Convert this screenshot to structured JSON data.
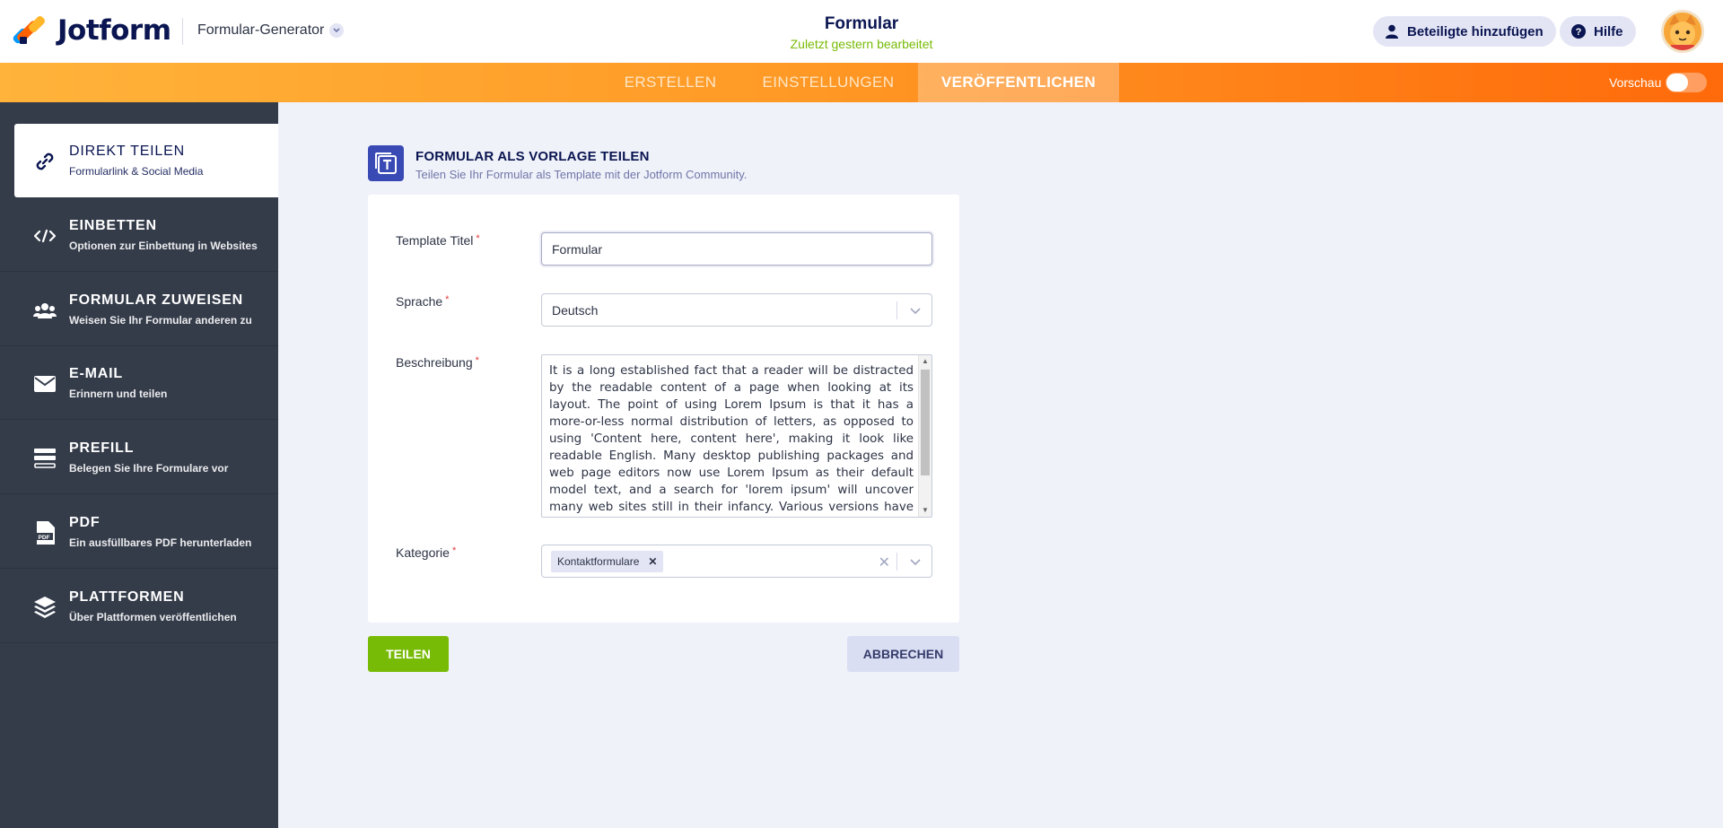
{
  "header": {
    "logo_text": "Jotform",
    "form_generator_label": "Formular-Generator",
    "form_title": "Formular",
    "form_subtitle": "Zuletzt gestern bearbeitet",
    "add_participants_label": "Beteiligte hinzufügen",
    "help_label": "Hilfe",
    "icons": [
      "user-icon",
      "help-icon",
      "chevron-down-icon"
    ]
  },
  "nav": {
    "tabs": [
      {
        "label": "ERSTELLEN"
      },
      {
        "label": "EINSTELLUNGEN"
      },
      {
        "label": "VERÖFFENTLICHEN",
        "active": true
      }
    ],
    "preview_label": "Vorschau",
    "preview_enabled": false
  },
  "sidebar": {
    "items": [
      {
        "title": "DIREKT TEILEN",
        "subtitle": "Formularlink & Social Media",
        "icon": "link-icon",
        "active": true
      },
      {
        "title": "EINBETTEN",
        "subtitle": "Optionen zur Einbettung in Websites",
        "icon": "code-icon"
      },
      {
        "title": "FORMULAR ZUWEISEN",
        "subtitle": "Weisen Sie Ihr Formular anderen zu",
        "icon": "users-icon"
      },
      {
        "title": "E-MAIL",
        "subtitle": "Erinnern und teilen",
        "icon": "mail-icon"
      },
      {
        "title": "PREFILL",
        "subtitle": "Belegen Sie Ihre Formulare vor",
        "icon": "prefill-icon"
      },
      {
        "title": "PDF",
        "subtitle": "Ein ausfüllbares PDF herunterladen",
        "icon": "pdf-icon"
      },
      {
        "title": "PLATTFORMEN",
        "subtitle": "Über Plattformen veröffentlichen",
        "icon": "layers-icon"
      }
    ]
  },
  "section": {
    "title": "FORMULAR ALS VORLAGE TEILEN",
    "subtitle": "Teilen Sie Ihr Formular als Template mit der Jotform Community.",
    "icon": "template-icon"
  },
  "form": {
    "template_title_label": "Template Titel",
    "template_title_value": "Formular",
    "language_label": "Sprache",
    "language_value": "Deutsch",
    "description_label": "Beschreibung",
    "description_value": "It is a long established fact that a reader will be distracted by the readable content of a page when looking at its layout. The point of using Lorem Ipsum is that it has a more-or-less normal distribution of letters, as opposed to using 'Content here, content here', making it look like readable English. Many desktop publishing packages and web page editors now use Lorem Ipsum as their default model text, and a search for 'lorem ipsum' will uncover many web sites still in their infancy. Various versions have evolved over the years,",
    "category_label": "Kategorie",
    "category_tags": [
      "Kontaktformulare"
    ],
    "required_marker": "*"
  },
  "actions": {
    "share_label": "TEILEN",
    "cancel_label": "ABBRECHEN"
  },
  "colors": {
    "accent_orange": "#ff6100",
    "success_green": "#78bb07",
    "sidebar_bg": "#343c4a",
    "brand_navy": "#0a1551"
  }
}
